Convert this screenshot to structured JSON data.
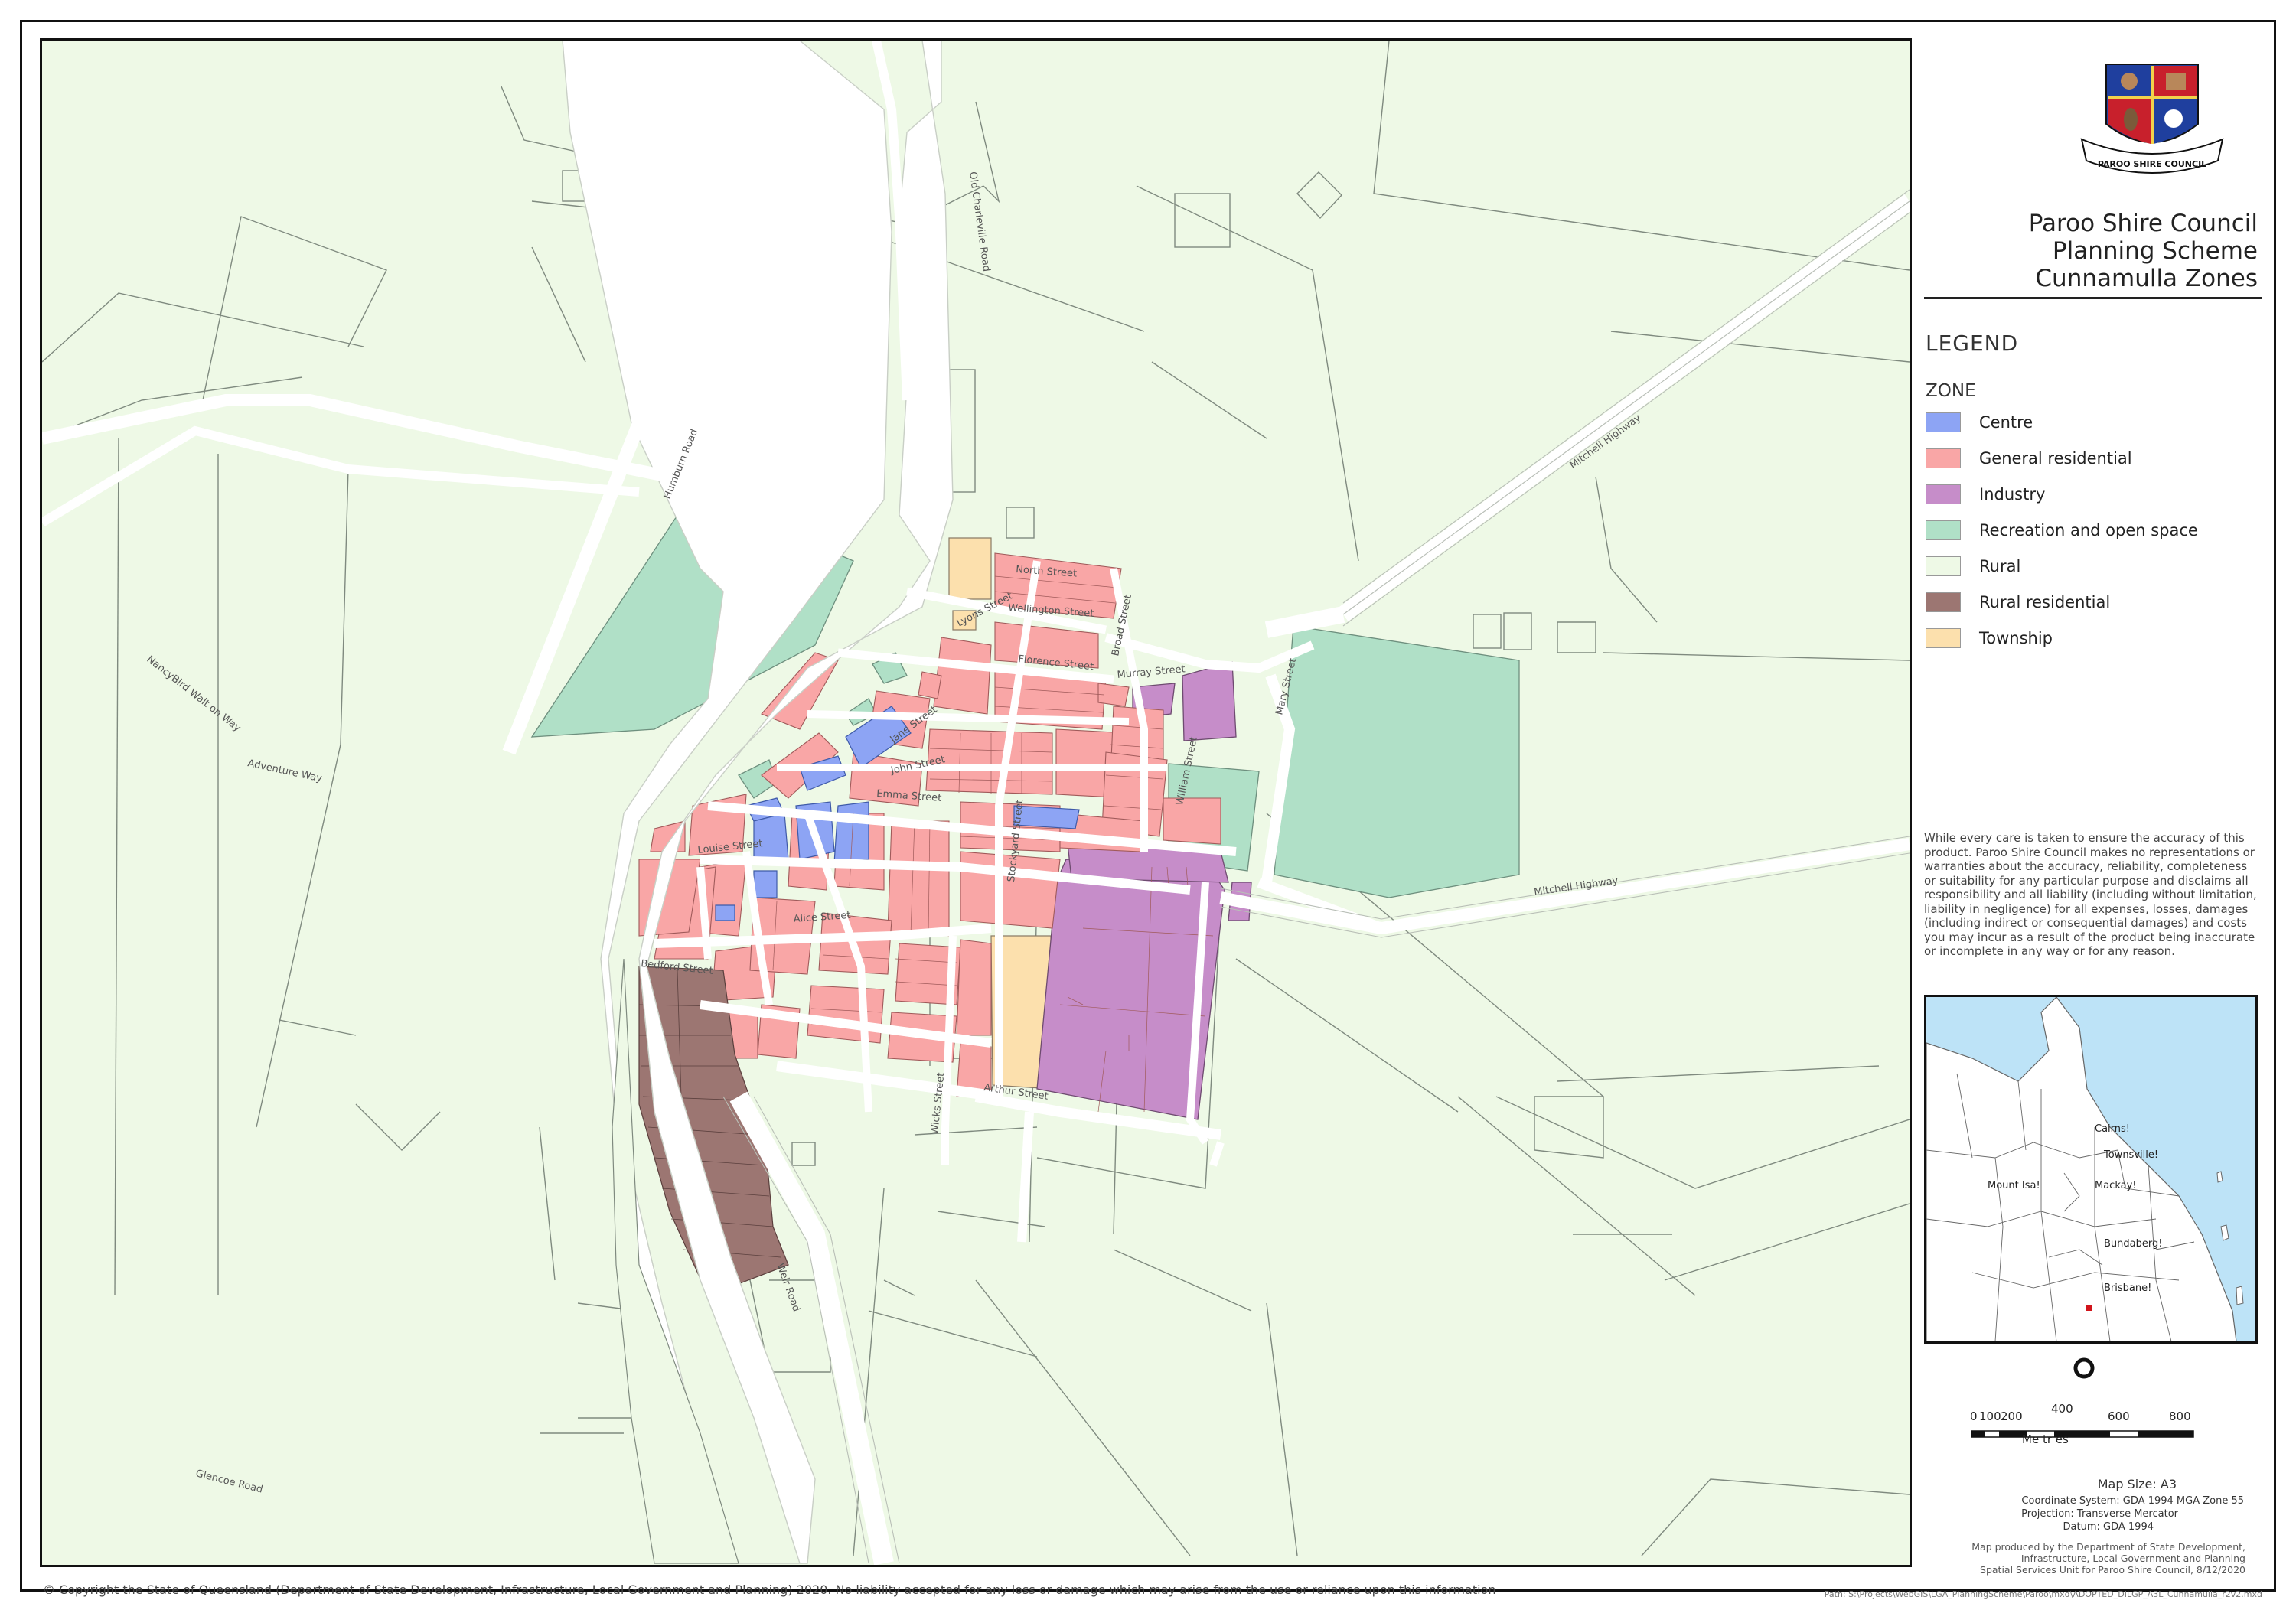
{
  "header": {
    "council": "Paroo Shire Council",
    "scheme": "Planning Scheme",
    "map_name": "Cunnamulla Zones",
    "logo_text": "PAROO SHIRE COUNCIL"
  },
  "legend": {
    "title": "LEGEND",
    "group": "ZONE",
    "items": [
      {
        "label": "Centre",
        "color": "#8da4f4"
      },
      {
        "label": "General residential",
        "color": "#f9a6a6"
      },
      {
        "label": "Industry",
        "color": "#c68dc9"
      },
      {
        "label": "Recreation and open space",
        "color": "#b0e0c7"
      },
      {
        "label": "Rural",
        "color": "#eef9e6"
      },
      {
        "label": "Rural residential",
        "color": "#9c7672"
      },
      {
        "label": "Township",
        "color": "#fce0ad"
      }
    ]
  },
  "disclaimer": "While every care is taken to ensure the accuracy of this product. Paroo Shire Council makes no representations or warranties about the accuracy, reliability, completeness or suitability for any particular purpose and disclaims all responsibility and all liability (including without limitation, liability in negligence) for all expenses, losses, damages (including indirect or consequential damages) and costs you may incur as a result of the product being inaccurate or incomplete in any way or for any reason.",
  "inset_map": {
    "cities": [
      "Cairns!",
      "Townsville!",
      "Mount Isa!",
      "Mackay!",
      "Bundaberg!",
      "Brisbane!"
    ]
  },
  "scale_bar": {
    "ticks": [
      "0",
      "100",
      "200",
      "400",
      "600",
      "800"
    ],
    "units": "Me tr es"
  },
  "map_info": {
    "map_size": "Map Size:  A3",
    "coordinate_system": "Coordinate System: GDA 1994 MGA Zone 55",
    "projection": "Projection: Transverse Mercator",
    "datum": "Datum: GDA 1994"
  },
  "credits": {
    "line1": "Map produced by the Department of State Development,",
    "line2": "Infrastructure, Local Government and Planning",
    "line3": "Spatial Services Unit for Paroo Shire Council, 8/12/2020"
  },
  "footer": {
    "copyright": "© Copyright the State of Queensland (Department of State Development, Infrastructure, Local Government and Planning) 2020. No liability accepted for any loss or damage which may arise from the use or reliance upon this information",
    "path": "Path: S:\\Projects\\WebGIS\\LGA_PlanningScheme\\Paroo\\mxd\\ADOPTED_DILGP_A3L_Cunnamulla_r2v2.mxd"
  },
  "road_labels": {
    "humburn": "Humburn Road",
    "old_charleville": "Old Charleville Road",
    "mitchell_n": "Mitchell Highway",
    "mitchell_e": "Mitchell Highway",
    "nancybird": "NancyBird Walt on Way",
    "adventure": "Adventure Way",
    "weir": "Weir Road",
    "glencoe": "Glencoe Road",
    "north_st": "North Street",
    "wellington": "Wellington Street",
    "broad": "Broad Street",
    "murray": "Murray Street",
    "florence": "Florence Street",
    "mary": "Mary Street",
    "william": "William Street",
    "jane": "Jane Street",
    "john": "John Street",
    "emma": "Emma Street",
    "louise": "Louise Street",
    "alice": "Alice Street",
    "bedford": "Bedford Street",
    "arthur": "Arthur Street",
    "wicks": "Wicks Street",
    "stockyard": "Stockyard Street",
    "lyons": "Lyons Street"
  }
}
